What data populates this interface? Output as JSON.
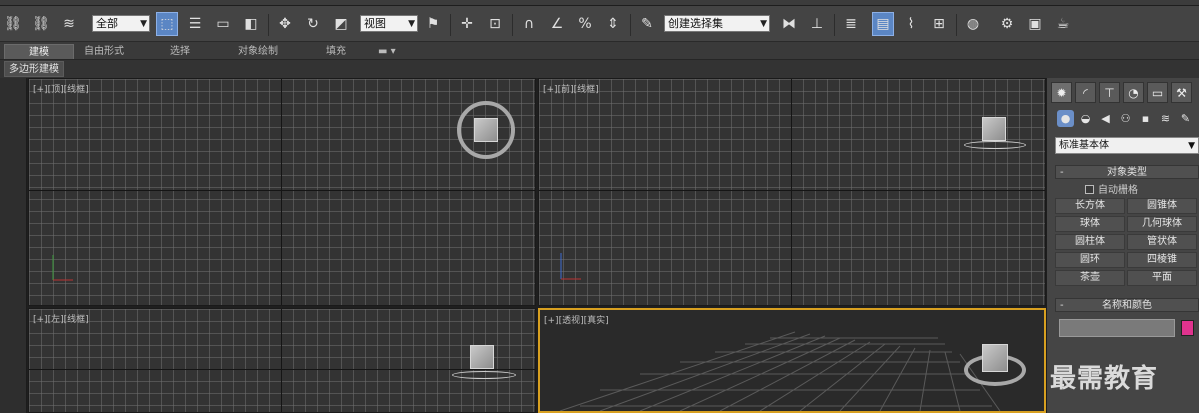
{
  "toolbar": {
    "selection_filter": "全部",
    "ref_coord_system": "视图",
    "named_selection_placeholder": "创建选择集"
  },
  "ribbon": {
    "tabs": [
      "建模",
      "自由形式",
      "选择",
      "对象绘制",
      "填充"
    ],
    "active_tab": "建模",
    "sub_panel": "多边形建模"
  },
  "viewports": {
    "top": {
      "bracket": "[+]",
      "view": "[顶]",
      "shading": "[线框]"
    },
    "front": {
      "bracket": "[+]",
      "view": "[前]",
      "shading": "[线框]"
    },
    "left": {
      "bracket": "[+]",
      "view": "[左]",
      "shading": "[线框]"
    },
    "perspective": {
      "bracket": "[+]",
      "view": "[透视]",
      "shading": "[真实]"
    }
  },
  "command_panel": {
    "category": "标准基本体",
    "object_type_title": "对象类型",
    "auto_grid_label": "自动栅格",
    "object_buttons": [
      "长方体",
      "圆锥体",
      "球体",
      "几何球体",
      "圆柱体",
      "管状体",
      "圆环",
      "四棱锥",
      "茶壶",
      "平面"
    ],
    "name_color_title": "名称和颜色",
    "object_color": "#e0338e"
  },
  "colors": {
    "active_viewport_border": "#d8a020",
    "active_button": "#5b86c4"
  },
  "watermark": "最需教育"
}
